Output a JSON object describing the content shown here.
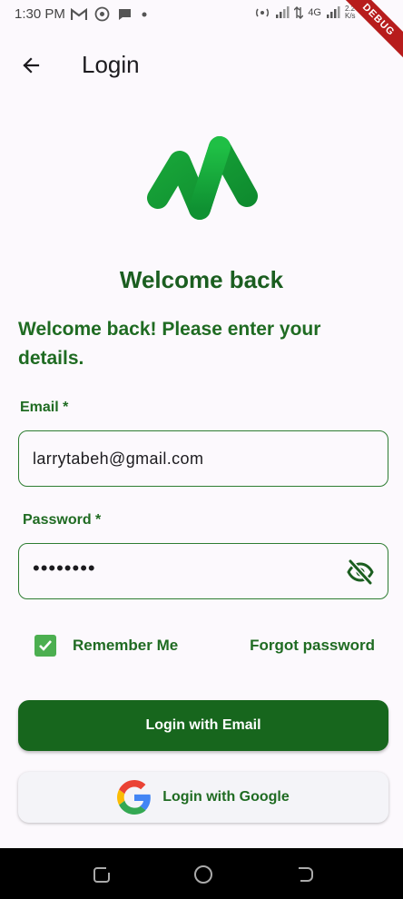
{
  "status_bar": {
    "time": "1:30 PM",
    "network_label": "4G",
    "speed_label": "2.2 K/s",
    "debug_banner": "DEBUG"
  },
  "app_bar": {
    "title": "Login",
    "back_icon": "arrow-left-icon"
  },
  "logo": {
    "icon": "m-logo-icon"
  },
  "welcome": {
    "title": "Welcome back",
    "subtitle": "Welcome back! Please enter your details."
  },
  "form": {
    "email": {
      "label": "Email *",
      "value": "larrytabeh@gmail.com"
    },
    "password": {
      "label": "Password *",
      "value": "••••••••",
      "toggle_icon": "eye-off-icon"
    },
    "remember_me": {
      "label": "Remember Me",
      "checked": true
    },
    "forgot_password": "Forgot password"
  },
  "buttons": {
    "login_email": "Login with Email",
    "login_google": "Login with Google"
  },
  "colors": {
    "primary": "#17661D",
    "label_green": "#1F6B22",
    "checkbox_green": "#4CAF50",
    "background": "#FCF9FD"
  }
}
